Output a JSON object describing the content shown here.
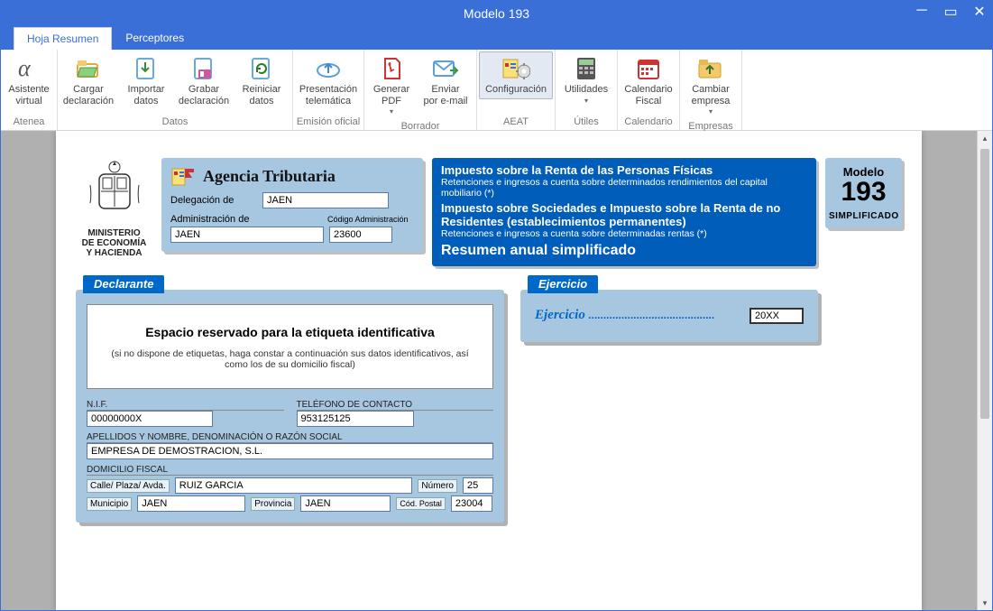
{
  "window": {
    "title": "Modelo 193"
  },
  "tabs": {
    "hoja": "Hoja Resumen",
    "perceptores": "Perceptores"
  },
  "ribbon": {
    "atenea": {
      "asistente": "Asistente\nvirtual",
      "group": "Atenea"
    },
    "datos": {
      "cargar": "Cargar\ndeclaración",
      "importar": "Importar\ndatos",
      "grabar": "Grabar\ndeclaración",
      "reiniciar": "Reiniciar\ndatos",
      "group": "Datos"
    },
    "emision": {
      "presentacion": "Presentación\ntelemática",
      "group": "Emisión oficial"
    },
    "borrador": {
      "generar": "Generar\nPDF",
      "enviar": "Enviar\npor e-mail",
      "group": "Borrador"
    },
    "aeat": {
      "config": "Configuración",
      "group": "AEAT"
    },
    "utiles": {
      "utilidades": "Utilidades",
      "group": "Útiles"
    },
    "calendario": {
      "fiscal": "Calendario\nFiscal",
      "group": "Calendario"
    },
    "empresas": {
      "cambiar": "Cambiar\nempresa",
      "group": "Empresas"
    }
  },
  "page": {
    "ministerio": {
      "l1": "MINISTERIO",
      "l2": "DE ECONOMÍA",
      "l3": "Y HACIENDA"
    },
    "agencia": {
      "title": "Agencia Tributaria",
      "delegacion_lbl": "Delegación de",
      "delegacion": "JAEN",
      "admin_lbl": "Administración de",
      "codadmin_lbl": "Código Administración",
      "admin": "JAEN",
      "codadmin": "23600"
    },
    "impuesto": {
      "l1": "Impuesto sobre la Renta de las Personas Físicas",
      "l2": "Retenciones e ingresos a cuenta sobre determinados rendimientos del capital mobiliario (*)",
      "l3": "Impuesto sobre Sociedades e Impuesto sobre la Renta de no Residentes   (establecimientos   permanentes)",
      "l4": "Retenciones e ingresos a cuenta sobre determinadas rentas (*)",
      "resumen": "Resumen anual simplificado"
    },
    "modelo": {
      "m": "Modelo",
      "n": "193",
      "s": "SIMPLIFICADO"
    },
    "declarante": {
      "title": "Declarante",
      "box_h": "Espacio reservado para la etiqueta identificativa",
      "box_p": "(si no dispone de etiquetas, haga constar a continuación sus datos identificativos, así como los de su domicilio fiscal)",
      "nif_lbl": "N.I.F.",
      "nif": "00000000X",
      "tel_lbl": "TELÉFONO DE CONTACTO",
      "tel": "953125125",
      "razon_lbl": "APELLIDOS Y NOMBRE, DENOMINACIÓN O RAZÓN SOCIAL",
      "razon": "EMPRESA DE DEMOSTRACION, S.L.",
      "dom_lbl": "DOMICILIO FISCAL",
      "calle_lbl": "Calle/ Plaza/ Avda.",
      "calle": "RUIZ GARCIA",
      "num_lbl": "Número",
      "num": "25",
      "muni_lbl": "Municipio",
      "muni": "JAEN",
      "prov_lbl": "Provincia",
      "prov": "JAEN",
      "cp_lbl": "Cód. Postal",
      "cp": "23004"
    },
    "ejercicio": {
      "title": "Ejercicio",
      "lbl": "Ejercicio",
      "dots": " ..........................................",
      "val": "20XX"
    }
  }
}
